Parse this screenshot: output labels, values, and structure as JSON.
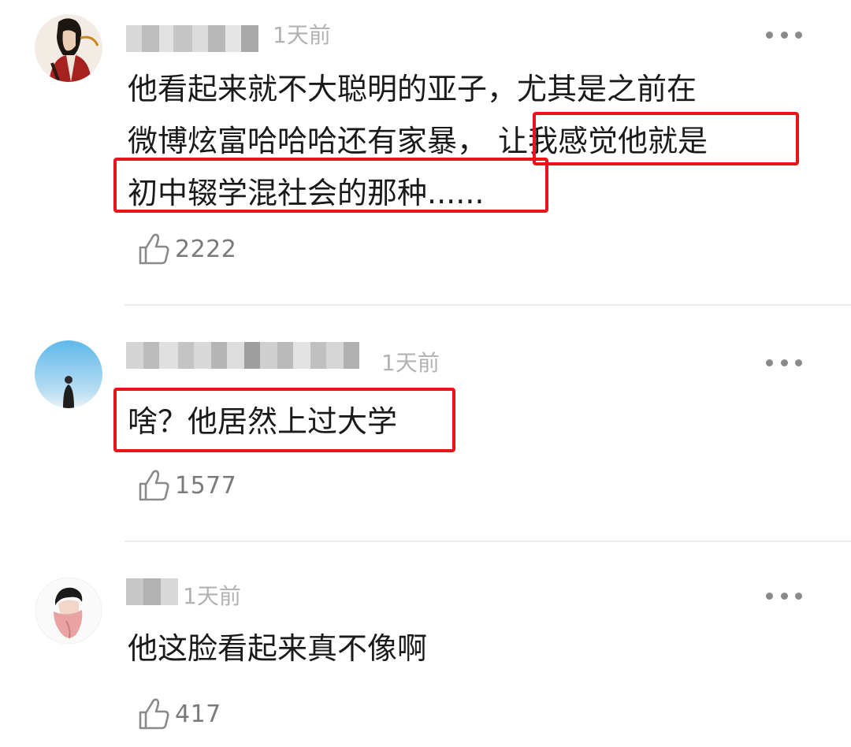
{
  "comments": [
    {
      "timestamp": "1天前",
      "lines": [
        "他看起来就不大聪明的亚子，尤其是之前在",
        "微博炫富哈哈哈还有家暴，",
        "让我感觉他就是",
        "初中辍学混社会的那种......"
      ],
      "likes": "2222"
    },
    {
      "timestamp": "1天前",
      "lines": [
        "啥？他居然上过大学"
      ],
      "likes": "1577"
    },
    {
      "timestamp": "1天前",
      "lines": [
        "他这脸看起来真不像啊"
      ],
      "likes": "417"
    }
  ],
  "icons": {
    "like": "thumbs-up-icon",
    "more": "more-horizontal-icon"
  },
  "colors": {
    "highlight_box": "#e8151b",
    "timestamp": "#b3b3b3",
    "like_count": "#7a7a7a",
    "body_text": "#1a1a1a",
    "divider": "#ececec"
  }
}
